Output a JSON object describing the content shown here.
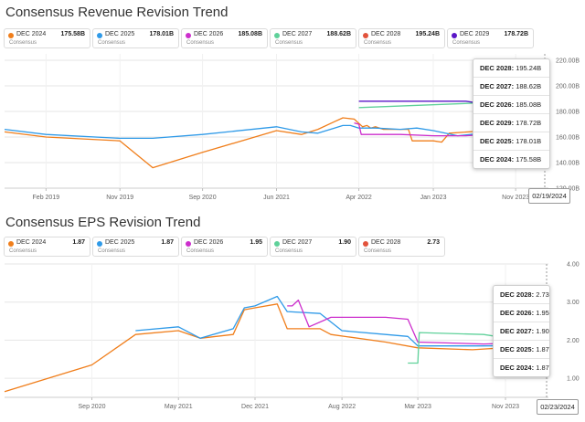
{
  "revenue": {
    "title": "Consensus Revenue Revision Trend",
    "legend": [
      {
        "name": "DEC 2024",
        "value": "175.58B",
        "sub": "Consensus",
        "color": "#f07e1b"
      },
      {
        "name": "DEC 2025",
        "value": "178.01B",
        "sub": "Consensus",
        "color": "#2f9ae8"
      },
      {
        "name": "DEC 2026",
        "value": "185.08B",
        "sub": "Consensus",
        "color": "#cc2ecc"
      },
      {
        "name": "DEC 2027",
        "value": "188.62B",
        "sub": "Consensus",
        "color": "#5fd19a"
      },
      {
        "name": "DEC 2028",
        "value": "195.24B",
        "sub": "Consensus",
        "color": "#e2533c"
      },
      {
        "name": "DEC 2029",
        "value": "178.72B",
        "sub": "Consensus",
        "color": "#5a16c7"
      }
    ],
    "tooltip": [
      {
        "label": "DEC 2028:",
        "value": "195.24B"
      },
      {
        "label": "DEC 2027:",
        "value": "188.62B"
      },
      {
        "label": "DEC 2026:",
        "value": "185.08B"
      },
      {
        "label": "DEC 2029:",
        "value": "178.72B"
      },
      {
        "label": "DEC 2025:",
        "value": "178.01B"
      },
      {
        "label": "DEC 2024:",
        "value": "175.58B"
      }
    ],
    "date": "02/19/2024"
  },
  "eps": {
    "title": "Consensus EPS Revision Trend",
    "legend": [
      {
        "name": "DEC 2024",
        "value": "1.87",
        "sub": "Consensus",
        "color": "#f07e1b"
      },
      {
        "name": "DEC 2025",
        "value": "1.87",
        "sub": "Consensus",
        "color": "#2f9ae8"
      },
      {
        "name": "DEC 2026",
        "value": "1.95",
        "sub": "Consensus",
        "color": "#cc2ecc"
      },
      {
        "name": "DEC 2027",
        "value": "1.90",
        "sub": "Consensus",
        "color": "#5fd19a"
      },
      {
        "name": "DEC 2028",
        "value": "2.73",
        "sub": "Consensus",
        "color": "#e2533c"
      }
    ],
    "tooltip": [
      {
        "label": "DEC 2028:",
        "value": "2.73"
      },
      {
        "label": "DEC 2026:",
        "value": "1.95"
      },
      {
        "label": "DEC 2027:",
        "value": "1.90"
      },
      {
        "label": "DEC 2025:",
        "value": "1.87"
      },
      {
        "label": "DEC 2024:",
        "value": "1.87"
      }
    ],
    "date": "02/23/2024"
  },
  "chart_data": [
    {
      "type": "line",
      "title": "Consensus Revenue Revision Trend",
      "y_unit": "B",
      "ylim": [
        120,
        225
      ],
      "yticks": [
        120,
        140,
        160,
        180,
        200,
        220
      ],
      "ytick_labels": [
        "120.00B",
        "140.00B",
        "160.00B",
        "180.00B",
        "200.00B",
        "220.00B"
      ],
      "xlim": [
        "2018-09-01",
        "2024-03-01"
      ],
      "xticks": [
        "2019-02-01",
        "2019-11-01",
        "2020-09-01",
        "2021-06-01",
        "2022-04-01",
        "2023-01-01",
        "2023-11-01"
      ],
      "xtick_labels": [
        "Feb 2019",
        "Nov 2019",
        "Sep 2020",
        "Jun 2021",
        "Apr 2022",
        "Jan 2023",
        "Nov 2023"
      ],
      "grid": true,
      "series": [
        {
          "name": "DEC 2024",
          "color": "#f07e1b",
          "points": [
            [
              "2018-09-01",
              164
            ],
            [
              "2019-02-01",
              160
            ],
            [
              "2019-11-01",
              157
            ],
            [
              "2020-03-01",
              136
            ],
            [
              "2020-09-01",
              148
            ],
            [
              "2021-06-01",
              165
            ],
            [
              "2021-09-01",
              162
            ],
            [
              "2021-11-01",
              166
            ],
            [
              "2022-01-01",
              172
            ],
            [
              "2022-02-01",
              175
            ],
            [
              "2022-03-15",
              174
            ],
            [
              "2022-04-15",
              168
            ],
            [
              "2022-05-01",
              169
            ],
            [
              "2022-05-15",
              167
            ],
            [
              "2022-06-01",
              168
            ],
            [
              "2022-07-01",
              166
            ],
            [
              "2022-10-01",
              166
            ],
            [
              "2022-10-15",
              157
            ],
            [
              "2023-01-01",
              157
            ],
            [
              "2023-02-01",
              156
            ],
            [
              "2023-03-01",
              163
            ],
            [
              "2023-10-01",
              166
            ],
            [
              "2024-02-19",
              175.58
            ]
          ]
        },
        {
          "name": "DEC 2025",
          "color": "#2f9ae8",
          "points": [
            [
              "2018-09-01",
              166
            ],
            [
              "2019-02-01",
              162
            ],
            [
              "2019-11-01",
              159
            ],
            [
              "2020-03-01",
              159
            ],
            [
              "2020-09-01",
              162
            ],
            [
              "2021-06-01",
              168
            ],
            [
              "2021-09-01",
              164
            ],
            [
              "2021-11-01",
              163
            ],
            [
              "2022-01-01",
              167
            ],
            [
              "2022-02-01",
              169
            ],
            [
              "2022-03-01",
              169
            ],
            [
              "2022-04-01",
              167
            ],
            [
              "2022-06-01",
              167
            ],
            [
              "2022-09-01",
              166
            ],
            [
              "2022-11-01",
              167
            ],
            [
              "2023-01-01",
              165
            ],
            [
              "2023-04-01",
              161
            ],
            [
              "2023-07-01",
              163
            ],
            [
              "2023-10-01",
              165
            ],
            [
              "2024-02-19",
              178.01
            ]
          ]
        },
        {
          "name": "DEC 2026",
          "color": "#cc2ecc",
          "points": [
            [
              "2022-03-15",
              171
            ],
            [
              "2022-04-01",
              170
            ],
            [
              "2022-04-10",
              162
            ],
            [
              "2022-06-01",
              162
            ],
            [
              "2022-09-01",
              162
            ],
            [
              "2023-01-01",
              161
            ],
            [
              "2023-05-01",
              161
            ],
            [
              "2023-10-01",
              163
            ],
            [
              "2024-02-19",
              185.08
            ]
          ]
        },
        {
          "name": "DEC 2027",
          "color": "#5fd19a",
          "points": [
            [
              "2022-04-01",
              183
            ],
            [
              "2024-02-19",
              188.62
            ]
          ]
        },
        {
          "name": "DEC 2028",
          "color": "#e2533c",
          "points": [
            [
              "2023-11-01",
              190
            ],
            [
              "2024-02-19",
              195.24
            ]
          ]
        },
        {
          "name": "DEC 2029",
          "color": "#5a16c7",
          "points": [
            [
              "2022-04-01",
              188
            ],
            [
              "2023-05-01",
              188
            ],
            [
              "2024-02-19",
              178.72
            ]
          ]
        }
      ]
    },
    {
      "type": "line",
      "title": "Consensus EPS Revision Trend",
      "ylim": [
        0.5,
        4.0
      ],
      "yticks": [
        1,
        2,
        3,
        4
      ],
      "ytick_labels": [
        "1.00",
        "2.00",
        "3.00",
        "4.00"
      ],
      "xlim": [
        "2020-01-01",
        "2024-02-29"
      ],
      "xticks": [
        "2020-09-01",
        "2021-05-01",
        "2021-12-01",
        "2022-08-01",
        "2023-03-01",
        "2023-11-01"
      ],
      "xtick_labels": [
        "Sep 2020",
        "May 2021",
        "Dec 2021",
        "Aug 2022",
        "Mar 2023",
        "Nov 2023"
      ],
      "grid": true,
      "series": [
        {
          "name": "DEC 2024",
          "color": "#f07e1b",
          "points": [
            [
              "2020-01-01",
              0.65
            ],
            [
              "2020-09-01",
              1.35
            ],
            [
              "2021-01-01",
              2.15
            ],
            [
              "2021-05-01",
              2.25
            ],
            [
              "2021-07-01",
              2.05
            ],
            [
              "2021-10-01",
              2.15
            ],
            [
              "2021-11-01",
              2.8
            ],
            [
              "2021-12-01",
              2.85
            ],
            [
              "2022-02-01",
              2.95
            ],
            [
              "2022-03-01",
              2.3
            ],
            [
              "2022-06-01",
              2.3
            ],
            [
              "2022-07-01",
              2.15
            ],
            [
              "2022-12-01",
              1.95
            ],
            [
              "2023-03-01",
              1.8
            ],
            [
              "2023-08-01",
              1.75
            ],
            [
              "2024-02-23",
              1.87
            ]
          ]
        },
        {
          "name": "DEC 2025",
          "color": "#2f9ae8",
          "points": [
            [
              "2021-01-01",
              2.25
            ],
            [
              "2021-05-01",
              2.35
            ],
            [
              "2021-07-01",
              2.05
            ],
            [
              "2021-10-01",
              2.3
            ],
            [
              "2021-11-01",
              2.85
            ],
            [
              "2021-12-01",
              2.9
            ],
            [
              "2022-02-01",
              3.15
            ],
            [
              "2022-03-01",
              2.75
            ],
            [
              "2022-06-01",
              2.7
            ],
            [
              "2022-08-01",
              2.25
            ],
            [
              "2022-12-01",
              2.15
            ],
            [
              "2023-02-01",
              2.1
            ],
            [
              "2023-03-01",
              1.85
            ],
            [
              "2023-09-01",
              1.85
            ],
            [
              "2024-02-23",
              1.87
            ]
          ]
        },
        {
          "name": "DEC 2026",
          "color": "#cc2ecc",
          "points": [
            [
              "2022-03-01",
              2.9
            ],
            [
              "2022-03-15",
              2.9
            ],
            [
              "2022-04-01",
              3.05
            ],
            [
              "2022-05-01",
              2.35
            ],
            [
              "2022-07-01",
              2.6
            ],
            [
              "2022-12-01",
              2.6
            ],
            [
              "2023-02-01",
              2.55
            ],
            [
              "2023-03-01",
              1.95
            ],
            [
              "2023-09-01",
              1.9
            ],
            [
              "2024-02-23",
              1.95
            ]
          ]
        },
        {
          "name": "DEC 2027",
          "color": "#5fd19a",
          "points": [
            [
              "2023-02-01",
              1.4
            ],
            [
              "2023-03-01",
              1.4
            ],
            [
              "2023-03-05",
              2.2
            ],
            [
              "2023-09-01",
              2.15
            ],
            [
              "2024-02-23",
              1.9
            ]
          ]
        },
        {
          "name": "DEC 2028",
          "color": "#e2533c",
          "points": [
            [
              "2024-02-23",
              2.73
            ]
          ]
        }
      ]
    }
  ]
}
